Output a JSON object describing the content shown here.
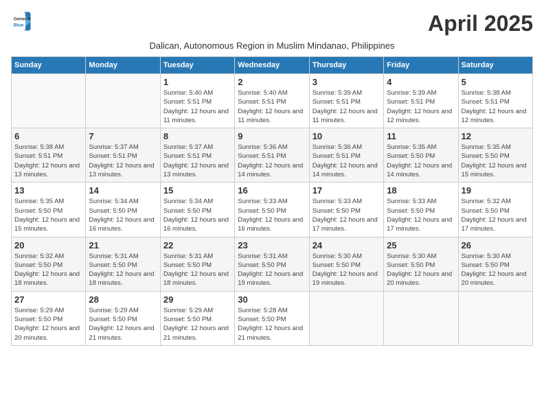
{
  "logo": {
    "line1": "General",
    "line2": "Blue"
  },
  "title": "April 2025",
  "subtitle": "Dalican, Autonomous Region in Muslim Mindanao, Philippines",
  "days_of_week": [
    "Sunday",
    "Monday",
    "Tuesday",
    "Wednesday",
    "Thursday",
    "Friday",
    "Saturday"
  ],
  "weeks": [
    [
      {
        "day": "",
        "info": ""
      },
      {
        "day": "",
        "info": ""
      },
      {
        "day": "1",
        "info": "Sunrise: 5:40 AM\nSunset: 5:51 PM\nDaylight: 12 hours and 11 minutes."
      },
      {
        "day": "2",
        "info": "Sunrise: 5:40 AM\nSunset: 5:51 PM\nDaylight: 12 hours and 11 minutes."
      },
      {
        "day": "3",
        "info": "Sunrise: 5:39 AM\nSunset: 5:51 PM\nDaylight: 12 hours and 11 minutes."
      },
      {
        "day": "4",
        "info": "Sunrise: 5:39 AM\nSunset: 5:51 PM\nDaylight: 12 hours and 12 minutes."
      },
      {
        "day": "5",
        "info": "Sunrise: 5:38 AM\nSunset: 5:51 PM\nDaylight: 12 hours and 12 minutes."
      }
    ],
    [
      {
        "day": "6",
        "info": "Sunrise: 5:38 AM\nSunset: 5:51 PM\nDaylight: 12 hours and 13 minutes."
      },
      {
        "day": "7",
        "info": "Sunrise: 5:37 AM\nSunset: 5:51 PM\nDaylight: 12 hours and 13 minutes."
      },
      {
        "day": "8",
        "info": "Sunrise: 5:37 AM\nSunset: 5:51 PM\nDaylight: 12 hours and 13 minutes."
      },
      {
        "day": "9",
        "info": "Sunrise: 5:36 AM\nSunset: 5:51 PM\nDaylight: 12 hours and 14 minutes."
      },
      {
        "day": "10",
        "info": "Sunrise: 5:36 AM\nSunset: 5:51 PM\nDaylight: 12 hours and 14 minutes."
      },
      {
        "day": "11",
        "info": "Sunrise: 5:35 AM\nSunset: 5:50 PM\nDaylight: 12 hours and 14 minutes."
      },
      {
        "day": "12",
        "info": "Sunrise: 5:35 AM\nSunset: 5:50 PM\nDaylight: 12 hours and 15 minutes."
      }
    ],
    [
      {
        "day": "13",
        "info": "Sunrise: 5:35 AM\nSunset: 5:50 PM\nDaylight: 12 hours and 15 minutes."
      },
      {
        "day": "14",
        "info": "Sunrise: 5:34 AM\nSunset: 5:50 PM\nDaylight: 12 hours and 16 minutes."
      },
      {
        "day": "15",
        "info": "Sunrise: 5:34 AM\nSunset: 5:50 PM\nDaylight: 12 hours and 16 minutes."
      },
      {
        "day": "16",
        "info": "Sunrise: 5:33 AM\nSunset: 5:50 PM\nDaylight: 12 hours and 16 minutes."
      },
      {
        "day": "17",
        "info": "Sunrise: 5:33 AM\nSunset: 5:50 PM\nDaylight: 12 hours and 17 minutes."
      },
      {
        "day": "18",
        "info": "Sunrise: 5:33 AM\nSunset: 5:50 PM\nDaylight: 12 hours and 17 minutes."
      },
      {
        "day": "19",
        "info": "Sunrise: 5:32 AM\nSunset: 5:50 PM\nDaylight: 12 hours and 17 minutes."
      }
    ],
    [
      {
        "day": "20",
        "info": "Sunrise: 5:32 AM\nSunset: 5:50 PM\nDaylight: 12 hours and 18 minutes."
      },
      {
        "day": "21",
        "info": "Sunrise: 5:31 AM\nSunset: 5:50 PM\nDaylight: 12 hours and 18 minutes."
      },
      {
        "day": "22",
        "info": "Sunrise: 5:31 AM\nSunset: 5:50 PM\nDaylight: 12 hours and 18 minutes."
      },
      {
        "day": "23",
        "info": "Sunrise: 5:31 AM\nSunset: 5:50 PM\nDaylight: 12 hours and 19 minutes."
      },
      {
        "day": "24",
        "info": "Sunrise: 5:30 AM\nSunset: 5:50 PM\nDaylight: 12 hours and 19 minutes."
      },
      {
        "day": "25",
        "info": "Sunrise: 5:30 AM\nSunset: 5:50 PM\nDaylight: 12 hours and 20 minutes."
      },
      {
        "day": "26",
        "info": "Sunrise: 5:30 AM\nSunset: 5:50 PM\nDaylight: 12 hours and 20 minutes."
      }
    ],
    [
      {
        "day": "27",
        "info": "Sunrise: 5:29 AM\nSunset: 5:50 PM\nDaylight: 12 hours and 20 minutes."
      },
      {
        "day": "28",
        "info": "Sunrise: 5:29 AM\nSunset: 5:50 PM\nDaylight: 12 hours and 21 minutes."
      },
      {
        "day": "29",
        "info": "Sunrise: 5:29 AM\nSunset: 5:50 PM\nDaylight: 12 hours and 21 minutes."
      },
      {
        "day": "30",
        "info": "Sunrise: 5:28 AM\nSunset: 5:50 PM\nDaylight: 12 hours and 21 minutes."
      },
      {
        "day": "",
        "info": ""
      },
      {
        "day": "",
        "info": ""
      },
      {
        "day": "",
        "info": ""
      }
    ]
  ]
}
